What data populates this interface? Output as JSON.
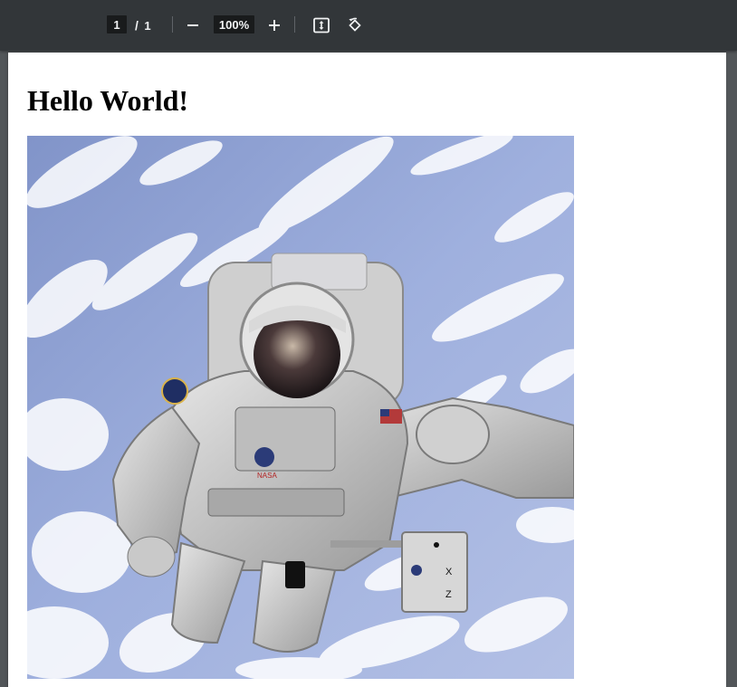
{
  "toolbar": {
    "page_current": "1",
    "page_separator": "/",
    "page_total": "1",
    "zoom_level": "100%",
    "icons": {
      "zoom_out": "minus-icon",
      "zoom_in": "plus-icon",
      "fit": "fit-to-page-icon",
      "rotate": "rotate-icon"
    }
  },
  "document": {
    "heading": "Hello World!",
    "image_subject": "astronaut floating in space above earth clouds"
  },
  "colors": {
    "toolbar_bg": "#323639",
    "viewer_bg": "#525659",
    "page_bg": "#ffffff",
    "sky": "#a8b7e0"
  }
}
